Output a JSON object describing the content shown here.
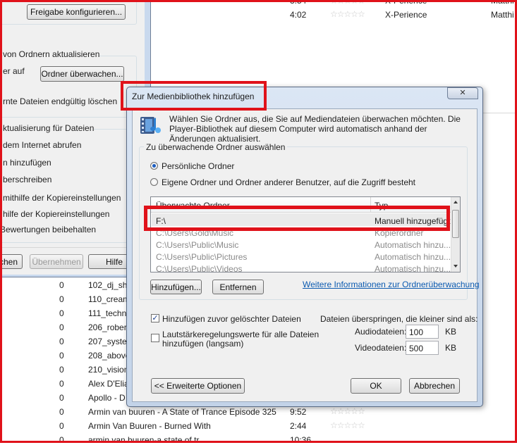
{
  "background_list": {
    "top_rows": [
      {
        "time": "3:54",
        "artist": "X-Perience",
        "composer": "Matthi"
      },
      {
        "time": "4:02",
        "artist": "X-Perience",
        "composer": "Matthi"
      }
    ],
    "rows": [
      {
        "count": "0",
        "title": "102_dj_sho",
        "time": ""
      },
      {
        "count": "0",
        "title": "110_cream",
        "time": ""
      },
      {
        "count": "0",
        "title": "111_techn",
        "time": ""
      },
      {
        "count": "0",
        "title": "206_robert",
        "time": ""
      },
      {
        "count": "0",
        "title": "207_systen",
        "time": ""
      },
      {
        "count": "0",
        "title": "208_above",
        "time": ""
      },
      {
        "count": "0",
        "title": "210_vision",
        "time": ""
      },
      {
        "count": "0",
        "title": "Alex D'Elia",
        "time": ""
      },
      {
        "count": "0",
        "title": "Apollo - D",
        "time": ""
      },
      {
        "count": "0",
        "title": "Armin van buuren - A State of Trance Episode 325",
        "time": "9:52"
      },
      {
        "count": "0",
        "title": "Armin Van Buuren - Burned With",
        "time": "2:44"
      },
      {
        "count": "0",
        "title": "armin van buuren-a state of tr",
        "time": "10:36"
      }
    ]
  },
  "options_window": {
    "share_button": "Freigabe konfigurieren...",
    "section_folders": "von Ordnern aktualisieren",
    "monitor_label": "er auf",
    "monitor_button": "Ordner überwachen...",
    "delete_text": "rnte Dateien endgültig löschen",
    "section_update": "ktualisierung für Dateien",
    "lines": [
      "dem Internet abrufen",
      "n hinzufügen",
      "berschreiben",
      "mithilfe der Kopiereinstellungen",
      "hilfe der Kopiereinstellungen",
      "Bewertungen beibehalten"
    ],
    "btn_cancel": "chen",
    "btn_apply": "Übernehmen",
    "btn_help": "Hilfe"
  },
  "dialog": {
    "title": "Zur Medienbibliothek hinzufügen",
    "close_label": "✕",
    "description": "Wählen Sie Ordner aus, die Sie auf Mediendateien überwachen möchten. Die Player-Bibliothek auf diesem Computer wird automatisch anhand der Änderungen aktualisiert.",
    "group_title": "Zu überwachende Ordner auswählen",
    "radio_personal": "Persönliche Ordner",
    "radio_all": "Eigene Ordner und Ordner anderer Benutzer, auf die Zugriff besteht",
    "col_folder": "Überwachte Ordner",
    "col_type": "Typ",
    "folders": [
      {
        "path": "F:\\",
        "type": "Manuell hinzugefügt",
        "muted": false
      },
      {
        "path": "C:\\Users\\Gold\\Music",
        "type": "Kopierordner",
        "muted": true
      },
      {
        "path": "C:\\Users\\Public\\Music",
        "type": "Automatisch hinzu...",
        "muted": true
      },
      {
        "path": "C:\\Users\\Public\\Pictures",
        "type": "Automatisch hinzu...",
        "muted": true
      },
      {
        "path": "C:\\Users\\Public\\Videos",
        "type": "Automatisch hinzu...",
        "muted": true
      }
    ],
    "btn_add": "Hinzufügen...",
    "btn_remove": "Entfernen",
    "link_more": "Weitere Informationen zur Ordnerüberwachung",
    "chk_deleted": "Hinzufügen zuvor gelöschter Dateien",
    "chk_volume_line1": "Lautstärkeregelungswerte für alle Dateien",
    "chk_volume_line2": "hinzufügen (langsam)",
    "skip_label": "Dateien überspringen, die kleiner sind als:",
    "audio_label": "Audiodateien:",
    "audio_value": "100",
    "video_label": "Videodateien:",
    "video_value": "500",
    "unit_kb": "KB",
    "btn_advanced": "<< Erweiterte Optionen",
    "btn_ok": "OK",
    "btn_cancel": "Abbrechen"
  },
  "colors": {
    "highlight_red": "#e0121a",
    "link_blue": "#0b5ab0",
    "dialog_frame": "#c7d6ea"
  }
}
